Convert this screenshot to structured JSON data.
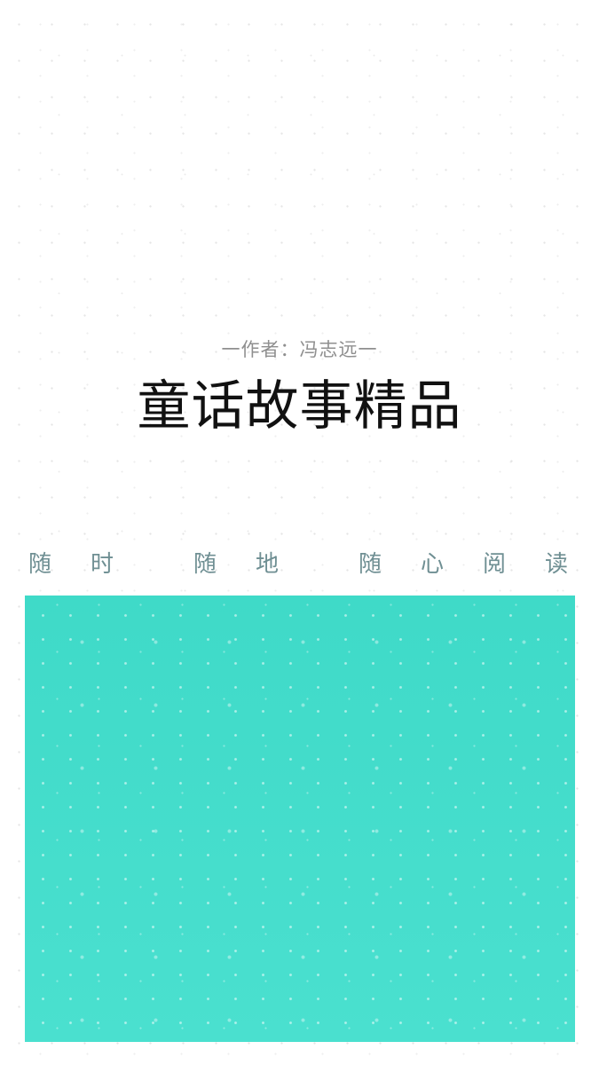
{
  "author_line": "一作者：冯志远一",
  "book_title": "童话故事精品",
  "tagline": [
    "随",
    "时",
    "随",
    "地",
    "随",
    "心",
    "阅",
    "读"
  ],
  "colors": {
    "background": "#ffffff",
    "panel": "#45dfcb",
    "tagline": "#6f8f93",
    "title": "#111111",
    "author": "#8f8f8f"
  }
}
